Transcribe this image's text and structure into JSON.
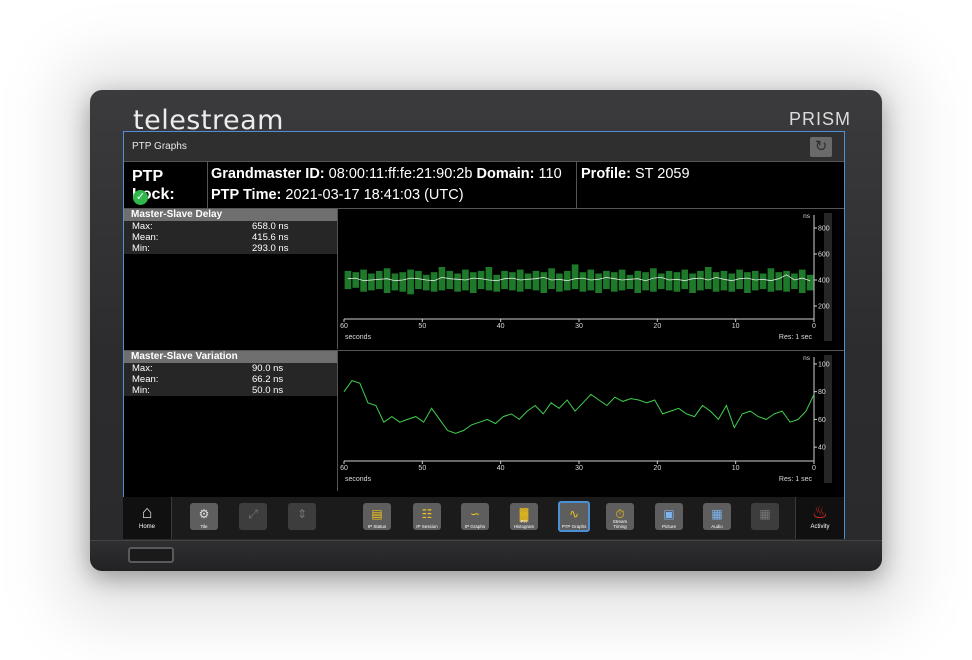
{
  "device": {
    "brand": "telestream",
    "model": "PRISM"
  },
  "window": {
    "title": "PTP Graphs",
    "reset_icon": "reset-icon"
  },
  "info": {
    "lock_label": "PTP Lock:",
    "lock_status_color": "#2fb84b",
    "grandmaster_label": "Grandmaster ID:",
    "grandmaster_value": "08:00:11:ff:fe:21:90:2b",
    "domain_label": "Domain:",
    "domain_value": "110",
    "ptp_time_label": "PTP Time:",
    "ptp_time_value": "2021-03-17 18:41:03 (UTC)",
    "profile_label": "Profile:",
    "profile_value": "ST 2059"
  },
  "panels": [
    {
      "title": "Master-Slave Delay",
      "stats": [
        {
          "label": "Max:",
          "value": "658.0 ns"
        },
        {
          "label": "Mean:",
          "value": "415.6 ns"
        },
        {
          "label": "Min:",
          "value": "293.0 ns"
        }
      ]
    },
    {
      "title": "Master-Slave Variation",
      "stats": [
        {
          "label": "Max:",
          "value": "90.0 ns"
        },
        {
          "label": "Mean:",
          "value": "66.2 ns"
        },
        {
          "label": "Min:",
          "value": "50.0 ns"
        }
      ]
    }
  ],
  "chart_data": [
    {
      "type": "bar",
      "unit": "ns",
      "x_axis_label": "seconds",
      "resolution_label": "Res: 1 sec",
      "x_ticks": [
        "60",
        "50",
        "40",
        "30",
        "20",
        "10",
        "0"
      ],
      "y_ticks": [
        "800",
        "600",
        "400",
        "200"
      ],
      "xlim": [
        60,
        0
      ],
      "ylim": [
        100,
        900
      ],
      "bar_color": "#1e7a2a",
      "line_color": "#ffffff",
      "lows": [
        330,
        340,
        310,
        320,
        330,
        300,
        320,
        310,
        290,
        330,
        320,
        310,
        320,
        330,
        310,
        320,
        300,
        330,
        320,
        310,
        330,
        320,
        310,
        330,
        320,
        300,
        330,
        310,
        320,
        330,
        310,
        320,
        300,
        330,
        310,
        320,
        330,
        300,
        320,
        310,
        330,
        320,
        310,
        330,
        300,
        320,
        330,
        310,
        320,
        310,
        330,
        300,
        320,
        330,
        310,
        320,
        310,
        330,
        300,
        320
      ],
      "highs": [
        470,
        460,
        480,
        450,
        470,
        490,
        450,
        460,
        480,
        470,
        440,
        460,
        500,
        470,
        450,
        480,
        460,
        470,
        500,
        440,
        470,
        460,
        480,
        450,
        470,
        460,
        490,
        450,
        470,
        520,
        460,
        480,
        450,
        470,
        460,
        480,
        440,
        470,
        460,
        490,
        450,
        470,
        460,
        480,
        450,
        470,
        500,
        460,
        470,
        450,
        480,
        460,
        470,
        450,
        490,
        460,
        470,
        450,
        480,
        440
      ],
      "mean": [
        410,
        415,
        395,
        400,
        405,
        410,
        395,
        400,
        415,
        410,
        400,
        395,
        420,
        410,
        405,
        400,
        415,
        410,
        400,
        395,
        410,
        415,
        400,
        405,
        410,
        420,
        400,
        405,
        395,
        410,
        415,
        400,
        405,
        420,
        410,
        400,
        405,
        410,
        395,
        415,
        420,
        400,
        405,
        395,
        410,
        415,
        400,
        420,
        405,
        395,
        410,
        415,
        400,
        405,
        395,
        410,
        440,
        400,
        415,
        395
      ]
    },
    {
      "type": "line",
      "unit": "ns",
      "x_axis_label": "seconds",
      "resolution_label": "Res: 1 sec",
      "x_ticks": [
        "60",
        "50",
        "40",
        "30",
        "20",
        "10",
        "0"
      ],
      "y_ticks": [
        "100",
        "80",
        "60",
        "40"
      ],
      "xlim": [
        60,
        0
      ],
      "ylim": [
        30,
        105
      ],
      "line_color": "#3fcf4f",
      "values": [
        80,
        88,
        86,
        72,
        70,
        58,
        62,
        58,
        60,
        62,
        58,
        68,
        60,
        52,
        50,
        52,
        56,
        58,
        60,
        57,
        62,
        64,
        60,
        66,
        70,
        64,
        72,
        68,
        74,
        66,
        72,
        78,
        74,
        70,
        76,
        73,
        75,
        74,
        72,
        74,
        64,
        66,
        68,
        64,
        62,
        70,
        66,
        60,
        70,
        54,
        64,
        66,
        62,
        60,
        64,
        66,
        58,
        60,
        66,
        78
      ]
    }
  ],
  "taskbar": {
    "home_label": "Home",
    "activity_label": "Activity",
    "items": [
      {
        "name": "Tile",
        "icon": "gear-icon",
        "enabled": true
      },
      {
        "name": "",
        "icon": "collapse-icon",
        "enabled": false
      },
      {
        "name": "",
        "icon": "move-icon",
        "enabled": false
      },
      {
        "name": "IP Status",
        "icon": "ip-status-icon",
        "enabled": true
      },
      {
        "name": "IP Session",
        "icon": "ip-session-icon",
        "enabled": true
      },
      {
        "name": "IP Graphs",
        "icon": "ip-graphs-icon",
        "enabled": true
      },
      {
        "name": "PIT Histogram",
        "icon": "histogram-icon",
        "enabled": true
      },
      {
        "name": "PTP Graphs",
        "icon": "ptp-graphs-icon",
        "enabled": true,
        "active": true
      },
      {
        "name": "Stream Timing",
        "icon": "stopwatch-icon",
        "enabled": true
      },
      {
        "name": "Picture",
        "icon": "picture-icon",
        "enabled": true
      },
      {
        "name": "Audio",
        "icon": "audio-icon",
        "enabled": true
      },
      {
        "name": "",
        "icon": "grid-icon",
        "enabled": false
      }
    ]
  },
  "colors": {
    "accent": "#4d8fd6",
    "activity_bell": "#e02b2b"
  }
}
